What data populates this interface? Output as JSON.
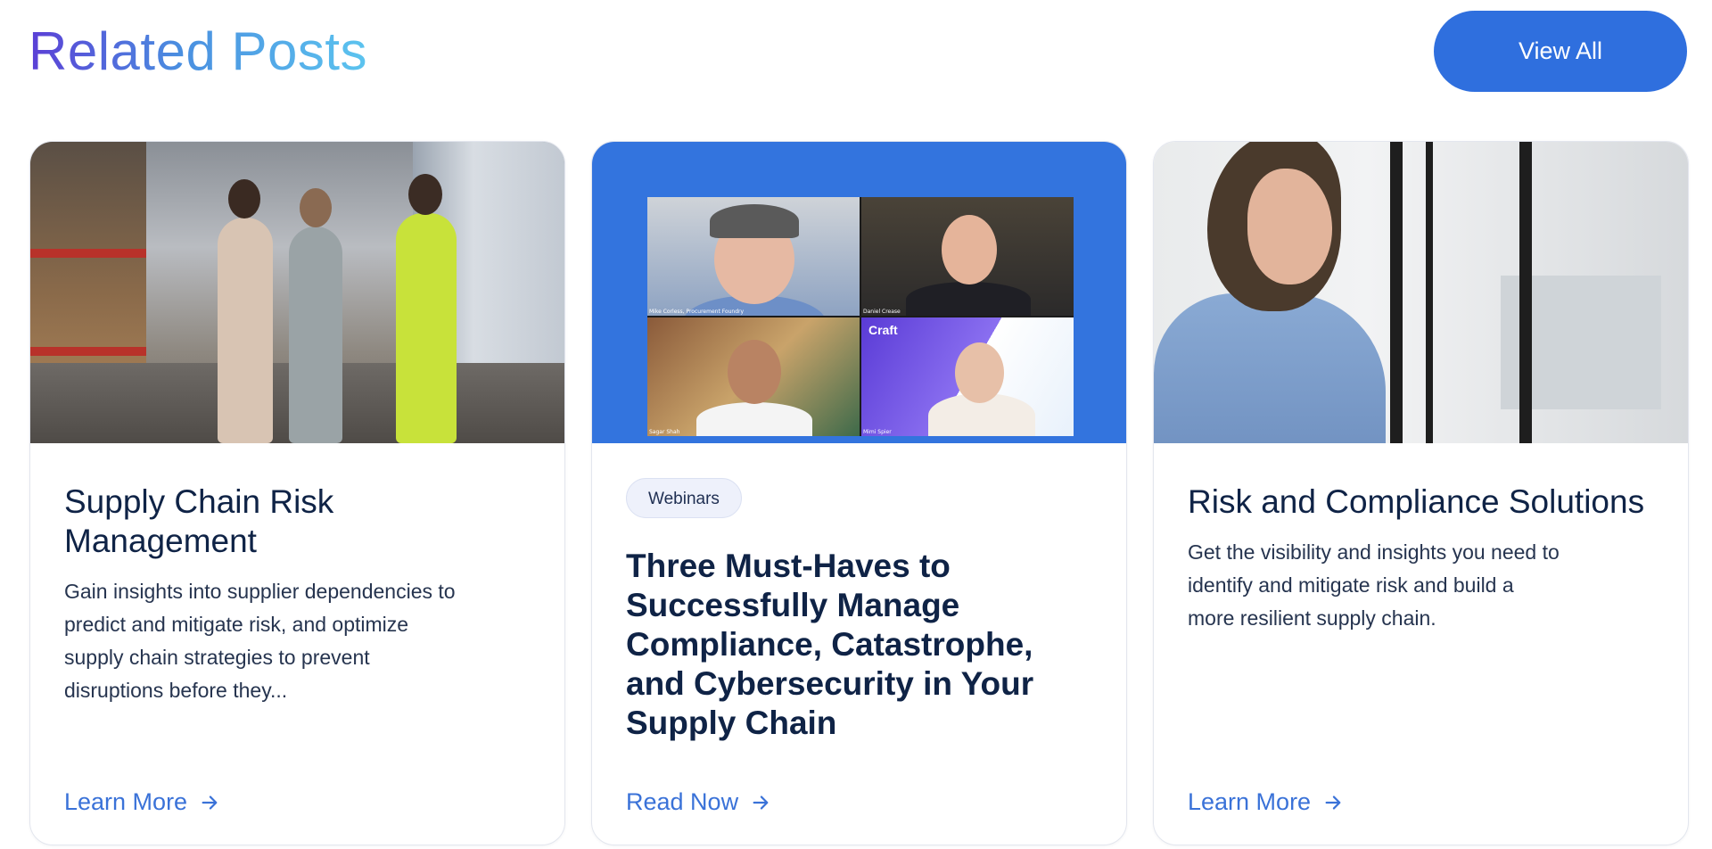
{
  "header": {
    "title": "Related Posts",
    "view_all_label": "View All"
  },
  "cards": [
    {
      "image_alt": "warehouse-photo",
      "title": "Supply Chain Risk Management",
      "description": "Gain insights into supplier dependencies to predict and mitigate risk, and optimize supply chain strategies to prevent disruptions before they...",
      "link_label": "Learn More"
    },
    {
      "image_alt": "webinar-video-grid",
      "badge": "Webinars",
      "title": "Three Must-Haves to Successfully Manage Compliance, Catastrophe, and Cybersecurity in Your Supply Chain",
      "link_label": "Read Now",
      "video_tiles": [
        {
          "name": "Mike Corless, Procurement Foundry"
        },
        {
          "name": "Daniel Crease"
        },
        {
          "name": "Sagar Shah"
        },
        {
          "name": "Mimi Spier",
          "logo": "Craft"
        }
      ]
    },
    {
      "image_alt": "woman-window-photo",
      "title": "Risk and Compliance Solutions",
      "description": "Get the visibility and insights you need to identify and mitigate risk and build a more resilient supply chain.",
      "link_label": "Learn More"
    }
  ],
  "colors": {
    "accent": "#2f6fde",
    "link": "#3a72d8",
    "title_gradient_start": "#5b3fd6",
    "title_gradient_end": "#5cc4ef"
  },
  "icons": {
    "link_arrow": "arrow-right-icon"
  }
}
